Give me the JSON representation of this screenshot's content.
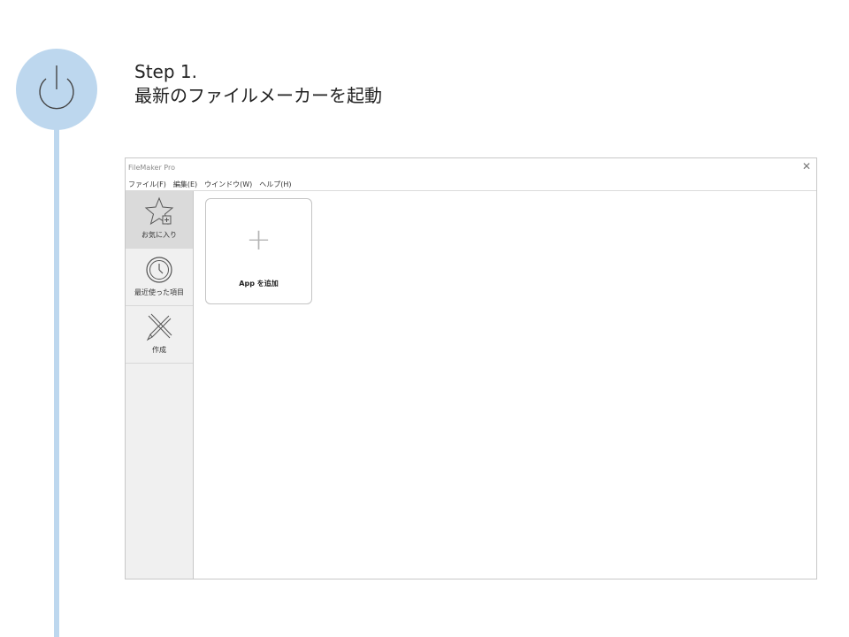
{
  "step": {
    "number_label": "Step 1.",
    "description": "最新のファイルメーカーを起動",
    "icon": "power-icon",
    "accent_color": "#bdd7ee"
  },
  "window": {
    "title": "FileMaker Pro",
    "close_glyph": "✕",
    "menu": [
      "ファイル(F)",
      "編集(E)",
      "ウインドウ(W)",
      "ヘルプ(H)"
    ],
    "sidebar": [
      {
        "label": "お気に入り",
        "icon": "star-add-icon",
        "active": true
      },
      {
        "label": "最近使った項目",
        "icon": "clock-icon",
        "active": false
      },
      {
        "label": "作成",
        "icon": "pencil-ruler-icon",
        "active": false
      }
    ],
    "add_card": {
      "plus_glyph": "+",
      "label": "App を追加"
    }
  }
}
